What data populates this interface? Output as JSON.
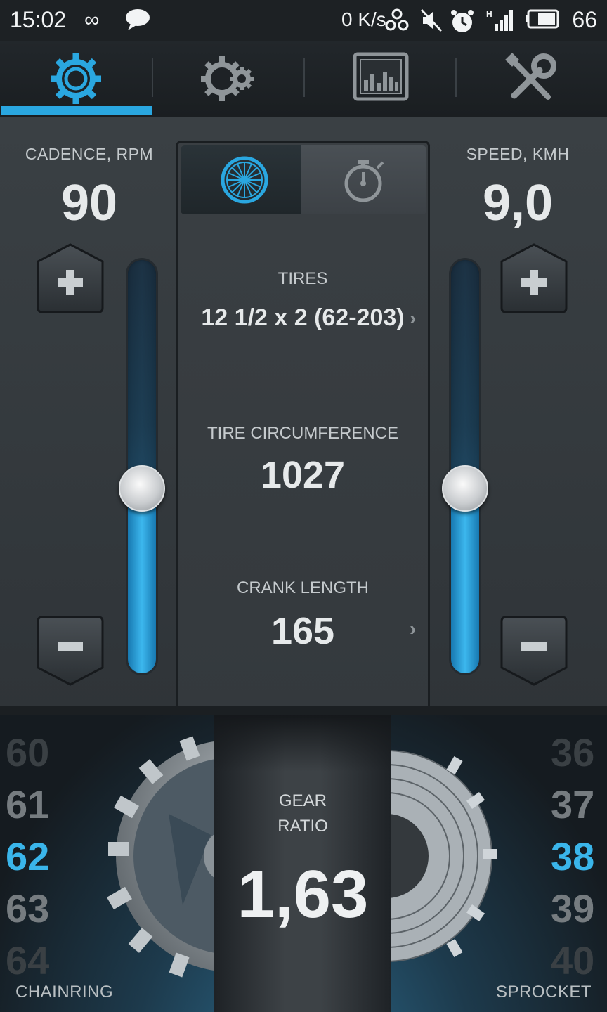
{
  "status_bar": {
    "time": "15:02",
    "net_speed": "0 K/s",
    "battery_level": "66"
  },
  "tabs": [
    {
      "name": "chainring-gear",
      "selected": true
    },
    {
      "name": "gear-set",
      "selected": false
    },
    {
      "name": "chart",
      "selected": false
    },
    {
      "name": "tools",
      "selected": false
    }
  ],
  "cadence": {
    "label": "CADENCE, RPM",
    "value": "90",
    "slider_level": 0.45
  },
  "speed": {
    "label": "SPEED, KMH",
    "value": "9,0",
    "slider_level": 0.45
  },
  "center": {
    "mode_tabs": [
      {
        "icon": "wheel-icon",
        "selected": true
      },
      {
        "icon": "stopwatch-icon",
        "selected": false
      }
    ],
    "tires_label": "TIRES",
    "tires_value": "12 1/2 x 2 (62-203)",
    "circ_label": "TIRE CIRCUMFERENCE",
    "circ_value": "1027",
    "crank_label": "CRANK LENGTH",
    "crank_value": "165"
  },
  "chainring": {
    "label": "CHAINRING",
    "values": [
      "60",
      "61",
      "62",
      "63",
      "64"
    ],
    "selected": "62"
  },
  "sprocket": {
    "label": "SPROCKET",
    "values": [
      "36",
      "37",
      "38",
      "39",
      "40"
    ],
    "selected": "38"
  },
  "gear_ratio": {
    "label_line1": "GEAR",
    "label_line2": "RATIO",
    "value": "1,63"
  },
  "colors": {
    "accent": "#2aa7e0",
    "selected_number": "#3ab5ea"
  }
}
